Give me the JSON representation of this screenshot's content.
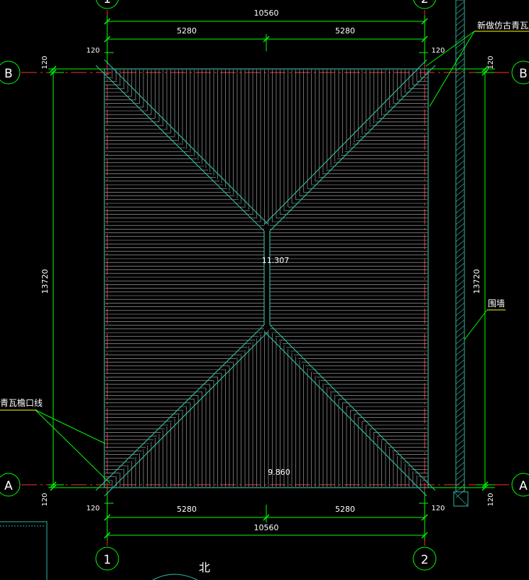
{
  "drawing": {
    "dims": {
      "top_total": "10560",
      "top_left": "5280",
      "top_right": "5280",
      "bottom_total": "10560",
      "bottom_left": "5280",
      "bottom_right": "5280",
      "offset_top_left": "120",
      "offset_top_right": "120",
      "offset_bottom_left": "120",
      "offset_bottom_right": "120",
      "offset_left_upper": "120",
      "offset_left_lower": "120",
      "offset_right_upper": "120",
      "offset_right_lower": "120",
      "left_height": "13720",
      "right_height": "13720"
    },
    "grid": {
      "col_1": "1",
      "col_2": "2",
      "row_a": "A",
      "row_b": "B"
    },
    "elevations": {
      "ridge": "11.307",
      "eave": "9.860"
    },
    "labels": {
      "roof_tile": "新做仿古青瓦屋面",
      "wall": "围墙",
      "eave_line": "青瓦檐口线",
      "north": "北"
    },
    "colors": {
      "background": "#000000",
      "dimension": "#00ff00",
      "roof_outline": "#2fb5a0",
      "hatch": "#c8c8c8",
      "axis": "#ff3030",
      "text": "#ffffff",
      "leader_underline": "#ffff00"
    }
  }
}
